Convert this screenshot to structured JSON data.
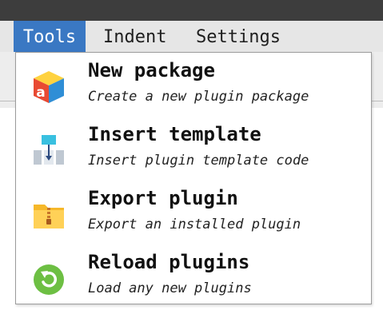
{
  "menubar": {
    "items": [
      {
        "label": "Tools"
      },
      {
        "label": "Indent"
      },
      {
        "label": "Settings"
      }
    ],
    "active_color": "#3a78c3"
  },
  "tools_menu": {
    "items": [
      {
        "label": "New package",
        "description": "Create a new plugin package",
        "icon": "package-icon"
      },
      {
        "label": "Insert template",
        "description": "Insert plugin template code",
        "icon": "template-icon"
      },
      {
        "label": "Export plugin",
        "description": "Export an installed plugin",
        "icon": "export-folder-icon"
      },
      {
        "label": "Reload plugins",
        "description": "Load any new plugins",
        "icon": "reload-icon"
      }
    ]
  }
}
